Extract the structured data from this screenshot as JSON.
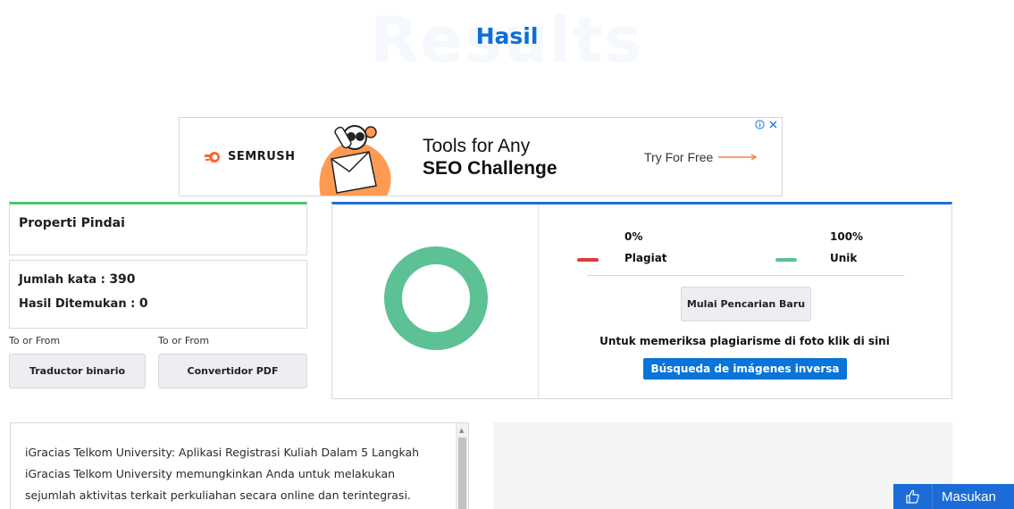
{
  "page": {
    "background_word": "Results",
    "title": "Hasil"
  },
  "ad": {
    "brand": "SEMRUSH",
    "headline_line1": "Tools for Any",
    "headline_line2": "SEO Challenge",
    "cta": "Try For Free",
    "brand_color": "#ff642d"
  },
  "scan_properties": {
    "heading": "Properti Pindai",
    "word_count_label": "Jumlah kata :",
    "word_count_value": "390",
    "results_found_label": "Hasil Ditemukan :",
    "results_found_value": "0"
  },
  "tools": [
    {
      "caption": "To or From",
      "button": "Traductor binario"
    },
    {
      "caption": "To or From",
      "button": "Convertidor PDF"
    }
  ],
  "results": {
    "plagiarism_percent": "0%",
    "plagiarism_label": "Plagiat",
    "plagiarism_color": "#e03a3a",
    "unique_percent": "100%",
    "unique_label": "Unik",
    "unique_color": "#5cc194",
    "new_search_button": "Mulai Pencarian Baru",
    "image_note": "Untuk memeriksa plagiarisme di foto klik di sini",
    "reverse_image_button": "Búsqueda de imágenes inversa"
  },
  "text_content": {
    "line1": "iGracias Telkom University: Aplikasi Registrasi Kuliah Dalam 5 Langkah",
    "line2": "iGracias Telkom University memungkinkan Anda untuk melakukan",
    "line3": "sejumlah aktivitas terkait perkuliahan secara online dan terintegrasi."
  },
  "feedback": {
    "label": "Masukan"
  }
}
